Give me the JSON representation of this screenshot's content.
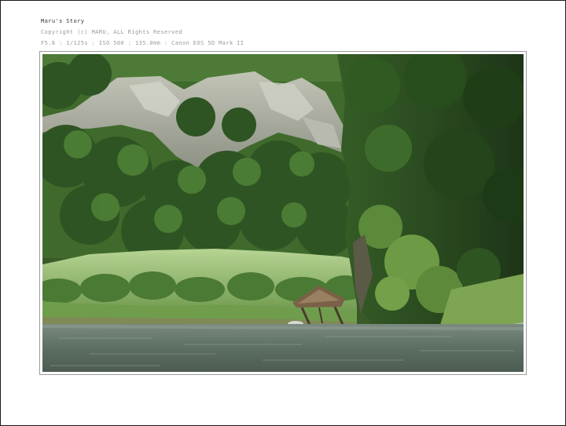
{
  "caption": {
    "title": "Maru's Story",
    "copyright": "Copyright (c) MARU, ALL Rights Reserved",
    "exif": "F5.6 : 1/125s : ISO 500 : 135.0mm : Canon EOS 5D Mark II"
  },
  "photo": {
    "subject": "river-landscape",
    "colors": {
      "sky_haze": "#8fa08a",
      "cliff_rock": "#a8ab9c",
      "forest_dark": "#22361d",
      "forest_mid": "#3f6a2c",
      "meadow_light": "#a9c98a",
      "water": "#5d6e63",
      "hut_thatch": "#7a6148"
    }
  }
}
